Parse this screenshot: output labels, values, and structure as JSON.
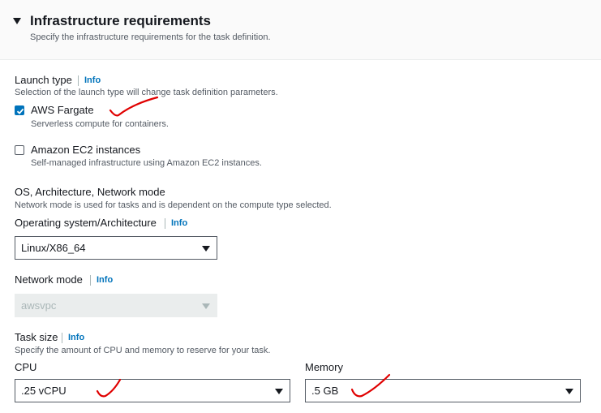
{
  "section": {
    "title": "Infrastructure requirements",
    "description": "Specify the infrastructure requirements for the task definition."
  },
  "launch_type": {
    "label": "Launch type",
    "info": "Info",
    "description": "Selection of the launch type will change task definition parameters.",
    "options": [
      {
        "label": "AWS Fargate",
        "description": "Serverless compute for containers.",
        "checked": true
      },
      {
        "label": "Amazon EC2 instances",
        "description": "Self-managed infrastructure using Amazon EC2 instances.",
        "checked": false
      }
    ]
  },
  "os_network": {
    "heading": "OS, Architecture, Network mode",
    "description": "Network mode is used for tasks and is dependent on the compute type selected.",
    "os_label": "Operating system/Architecture",
    "os_info": "Info",
    "os_value": "Linux/X86_64",
    "network_label": "Network mode",
    "network_info": "Info",
    "network_value": "awsvpc"
  },
  "task_size": {
    "label": "Task size",
    "info": "Info",
    "description": "Specify the amount of CPU and memory to reserve for your task.",
    "cpu_label": "CPU",
    "cpu_value": ".25 vCPU",
    "memory_label": "Memory",
    "memory_value": ".5 GB"
  },
  "colors": {
    "accent": "#0073bb",
    "annotation": "#e00000",
    "header_bg": "#fafafa"
  }
}
